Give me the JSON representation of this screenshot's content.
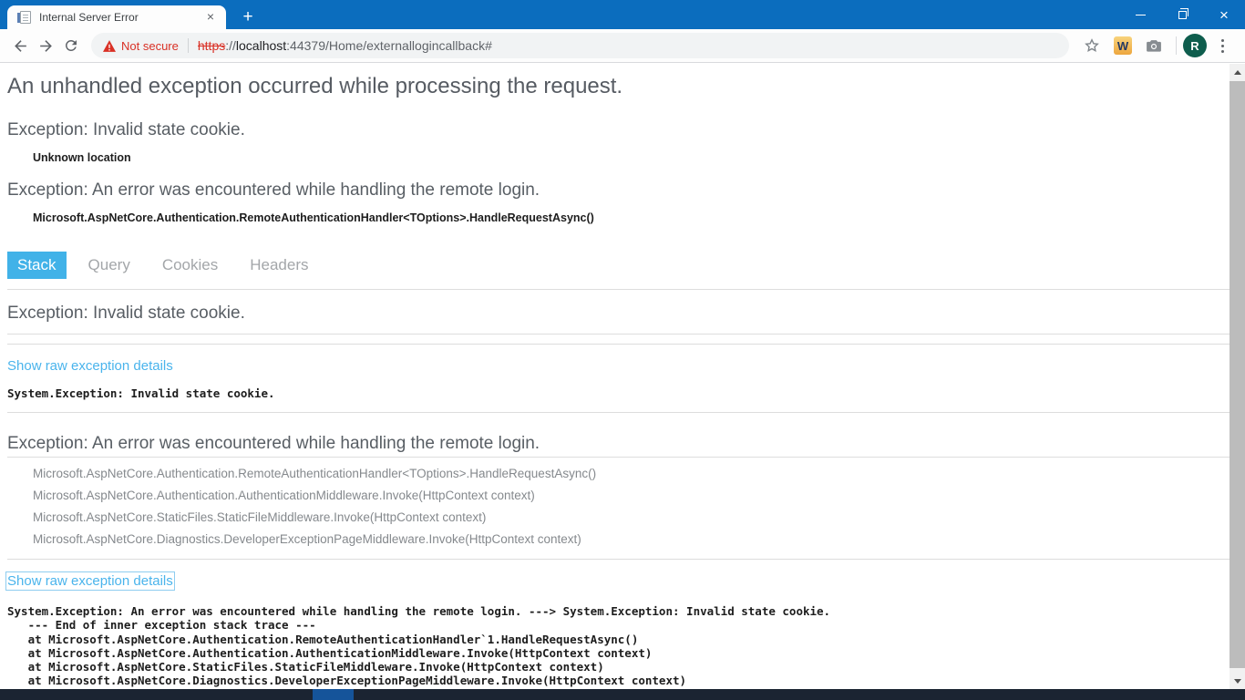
{
  "browser": {
    "tab": {
      "title": "Internal Server Error",
      "close_glyph": "×",
      "new_tab_glyph": "+"
    },
    "window_controls": {
      "close_glyph": "×"
    },
    "toolbar": {
      "security_warning": "Not secure",
      "url": {
        "scheme": "https",
        "separator": "://",
        "host": "localhost",
        "path": ":44379/Home/externallogincallback#"
      },
      "extension_letter": "W",
      "avatar_letter": "R"
    }
  },
  "page": {
    "title": "An unhandled exception occurred while processing the request.",
    "summary": [
      {
        "heading": "Exception: Invalid state cookie.",
        "detail": "Unknown location"
      },
      {
        "heading": "Exception: An error was encountered while handling the remote login.",
        "detail": "Microsoft.AspNetCore.Authentication.RemoteAuthenticationHandler<TOptions>.HandleRequestAsync()"
      }
    ],
    "tabs": [
      {
        "label": "Stack",
        "selected": true
      },
      {
        "label": "Query",
        "selected": false
      },
      {
        "label": "Cookies",
        "selected": false
      },
      {
        "label": "Headers",
        "selected": false
      }
    ],
    "stack_sections": [
      {
        "heading": "Exception: Invalid state cookie.",
        "frames": [],
        "raw_link": "Show raw exception details",
        "raw_trace": "System.Exception: Invalid state cookie."
      },
      {
        "heading": "Exception: An error was encountered while handling the remote login.",
        "frames": [
          "Microsoft.AspNetCore.Authentication.RemoteAuthenticationHandler<TOptions>.HandleRequestAsync()",
          "Microsoft.AspNetCore.Authentication.AuthenticationMiddleware.Invoke(HttpContext context)",
          "Microsoft.AspNetCore.StaticFiles.StaticFileMiddleware.Invoke(HttpContext context)",
          "Microsoft.AspNetCore.Diagnostics.DeveloperExceptionPageMiddleware.Invoke(HttpContext context)"
        ],
        "raw_link": "Show raw exception details",
        "raw_trace": "System.Exception: An error was encountered while handling the remote login. ---> System.Exception: Invalid state cookie.\n   --- End of inner exception stack trace ---\n   at Microsoft.AspNetCore.Authentication.RemoteAuthenticationHandler`1.HandleRequestAsync()\n   at Microsoft.AspNetCore.Authentication.AuthenticationMiddleware.Invoke(HttpContext context)\n   at Microsoft.AspNetCore.StaticFiles.StaticFileMiddleware.Invoke(HttpContext context)\n   at Microsoft.AspNetCore.Diagnostics.DeveloperExceptionPageMiddleware.Invoke(HttpContext context)"
      }
    ]
  },
  "colors": {
    "titlebar_blue": "#0b6dbe",
    "selected_tab_blue": "#41b2e8",
    "link_blue": "#4ab4ec",
    "warning_red": "#d93025",
    "avatar_green": "#0e5d4d",
    "taskbar_dark": "#1b2432",
    "taskbar_accent_blue": "#15549a"
  },
  "icons": {
    "favicon": "document-icon",
    "back": "back-arrow-icon",
    "forward": "forward-arrow-icon",
    "reload": "reload-icon",
    "warning": "warning-triangle-icon",
    "bookmark": "star-icon",
    "camera": "camera-icon",
    "menu": "three-dots-icon"
  }
}
